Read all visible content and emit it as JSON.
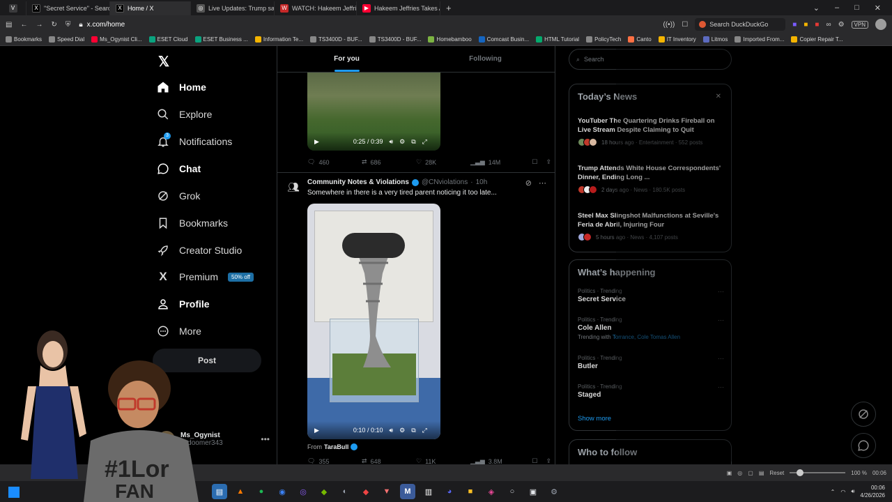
{
  "browser": {
    "tabs": [
      {
        "label": "\"Secret Service\" - Search /",
        "fav": "X",
        "fav_color": "#000000"
      },
      {
        "label": "Home / X",
        "fav": "X",
        "fav_color": "#000000",
        "active": true
      },
      {
        "label": "Live Updates: Trump safe a",
        "fav": "◎",
        "fav_color": "#555555"
      },
      {
        "label": "WATCH: Hakeem Jeffries Vo",
        "fav": "W",
        "fav_color": "#c62828"
      },
      {
        "label": "Hakeem Jeffries Takes Aim",
        "fav": "▶",
        "fav_color": "#ff0033"
      }
    ],
    "new_tab": "+",
    "url": "x.com/home",
    "search_placeholder": "Search DuckDuckGo",
    "vpn": "VPN",
    "bookmarks": [
      {
        "label": "Bookmarks",
        "color": "#888888"
      },
      {
        "label": "Speed Dial",
        "color": "#888888"
      },
      {
        "label": "Ms_Ogynist Cli...",
        "color": "#ff0033"
      },
      {
        "label": "ESET Cloud",
        "color": "#0aa37f"
      },
      {
        "label": "ESET Business ...",
        "color": "#0aa37f"
      },
      {
        "label": "Information Te...",
        "color": "#f4b400"
      },
      {
        "label": "TS3400D - BUF...",
        "color": "#888888"
      },
      {
        "label": "TS3400D - BUF...",
        "color": "#888888"
      },
      {
        "label": "Homebamboo",
        "color": "#7cb342"
      },
      {
        "label": "Comcast Busin...",
        "color": "#1565c0"
      },
      {
        "label": "HTML Tutorial",
        "color": "#04aa6d"
      },
      {
        "label": "PolicyTech",
        "color": "#888888"
      },
      {
        "label": "Canto",
        "color": "#ff7043"
      },
      {
        "label": "IT Inventory",
        "color": "#f4b400"
      },
      {
        "label": "Litmos",
        "color": "#5c6bc0"
      },
      {
        "label": "Imported From...",
        "color": "#888888"
      },
      {
        "label": "Copier Repair T...",
        "color": "#f4b400"
      }
    ]
  },
  "nav": {
    "items": [
      {
        "label": "Home",
        "icon": "home-icon",
        "bold": true
      },
      {
        "label": "Explore",
        "icon": "search-icon"
      },
      {
        "label": "Notifications",
        "icon": "bell-icon",
        "badge": "3"
      },
      {
        "label": "Chat",
        "icon": "chat-icon",
        "bold": true
      },
      {
        "label": "Grok",
        "icon": "grok-icon"
      },
      {
        "label": "Bookmarks",
        "icon": "bookmark-icon"
      },
      {
        "label": "Creator Studio",
        "icon": "rocket-icon"
      },
      {
        "label": "Premium",
        "icon": "x-icon",
        "badge": "50% off"
      },
      {
        "label": "Profile",
        "icon": "person-icon",
        "bold": true
      },
      {
        "label": "More",
        "icon": "more-icon"
      }
    ],
    "post_label": "Post",
    "account": {
      "name": "Ms_Ogynist",
      "handle": "@doomer343"
    }
  },
  "feed": {
    "tabs": [
      {
        "label": "For you",
        "active": true
      },
      {
        "label": "Following"
      }
    ],
    "tweet1": {
      "video_time": "0:25 / 0:39",
      "replies": "460",
      "reposts": "686",
      "likes": "28K",
      "views": "14M"
    },
    "tweet2": {
      "name": "Community Notes & Violations",
      "handle": "@CNviolations",
      "age": "10h",
      "text": "Somewhere in there is a very tired parent noticing it too late...",
      "video_time": "0:10 / 0:10",
      "from_prefix": "From",
      "from_name": "TaraBull",
      "replies": "355",
      "reposts": "648",
      "likes": "11K",
      "views": "3.8M"
    }
  },
  "right": {
    "search_placeholder": "Search",
    "todays_news": {
      "title": "Today’s News",
      "items": [
        {
          "headline": "YouTuber The Quartering Drinks Fireball on Live Stream Despite Claiming to Quit",
          "meta": "18 hours ago · Entertainment · 552 posts"
        },
        {
          "headline": "Trump Attends White House Correspondents' Dinner, Ending Long ...",
          "meta": "2 days ago · News · 180.5K posts"
        },
        {
          "headline": "Steel Max Slingshot Malfunctions at Seville's Feria de Abril, Injuring Four",
          "meta": "5 hours ago · News · 4,107 posts"
        }
      ]
    },
    "whats_happening": {
      "title": "What’s happening",
      "items": [
        {
          "category": "Politics · Trending",
          "name": "Secret Service"
        },
        {
          "category": "Politics · Trending",
          "name": "Cole Allen",
          "sub_prefix": "Trending with",
          "sub_links": "Torrance, Cole Tomas Allen"
        },
        {
          "category": "Politics · Trending",
          "name": "Butler"
        },
        {
          "category": "Politics · Trending",
          "name": "Staged"
        }
      ],
      "show_more": "Show more"
    },
    "who_to_follow": "Who to follow"
  },
  "statusbar": {
    "reset": "Reset",
    "zoom": "100 %",
    "time": "00:06"
  },
  "taskbar": {
    "time": "00:06",
    "date": "4/26/2026"
  }
}
